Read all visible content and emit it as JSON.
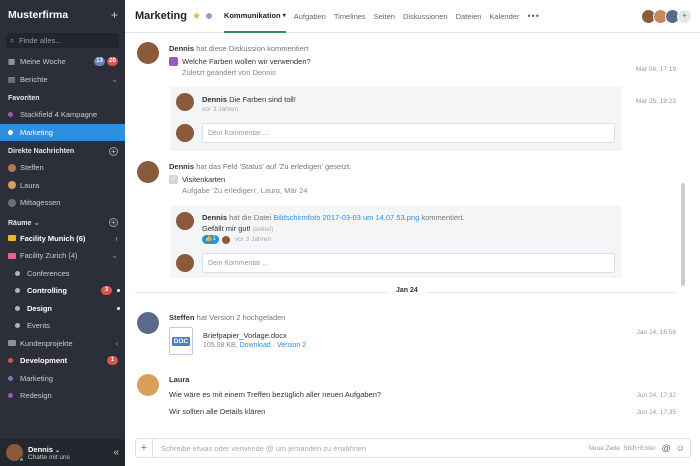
{
  "sidebar": {
    "workspace": "Musterfirma",
    "search_placeholder": "Finde alles...",
    "top_items": [
      {
        "label": "Meine Woche",
        "badge1": "13",
        "badge2": "20"
      },
      {
        "label": "Berichte"
      }
    ],
    "favorites_title": "Favoriten",
    "favorites": [
      {
        "label": "Stackfield 4 Kampagne",
        "color": "#9b59b6"
      },
      {
        "label": "Marketing",
        "color": "#ffffff"
      }
    ],
    "dm_title": "Direkte Nachrichten",
    "dms": [
      {
        "label": "Steffen"
      },
      {
        "label": "Laura"
      },
      {
        "label": "Mittagessen"
      }
    ],
    "rooms_title": "Räume",
    "rooms": [
      {
        "label": "Facility Munich (6)",
        "type": "folder",
        "color": "#f0b429"
      },
      {
        "label": "Facility Zurich (4)",
        "type": "folder",
        "color": "#e95f8e"
      },
      {
        "label": "Conferences",
        "type": "sub"
      },
      {
        "label": "Controlling",
        "type": "sub",
        "badge": "3"
      },
      {
        "label": "Design",
        "type": "sub"
      },
      {
        "label": "Events",
        "type": "sub"
      },
      {
        "label": "Kundenprojekte",
        "type": "folder",
        "color": "#8e8ea0"
      },
      {
        "label": "Development",
        "type": "item",
        "color": "#d9534f",
        "badge": "1"
      },
      {
        "label": "Marketing",
        "type": "item",
        "color": "#6a84b8"
      },
      {
        "label": "Redesign",
        "type": "item",
        "color": "#9b59b6"
      }
    ],
    "user_name": "Dennis",
    "user_status": "Chatte mit uns"
  },
  "header": {
    "title": "Marketing",
    "tabs": [
      "Kommunikation",
      "Aufgaben",
      "Timelines",
      "Seiten",
      "Diskussionen",
      "Dateien",
      "Kalender"
    ]
  },
  "feed": {
    "e1": {
      "name": "Dennis",
      "action": "hat diese Diskussion kommentiert",
      "topic": "Welche Farben wollen wir verwenden?",
      "changed": "Zuletzt geändert von Dennis",
      "date": "Mar 06, 17:19",
      "reply_name": "Dennis",
      "reply_text": "Die Farben sind toll!",
      "reply_age": "vor 3 Jahren",
      "reply_date": "Mar 25, 19:23",
      "comment_ph": "Dein Kommentar ..."
    },
    "e2": {
      "name": "Dennis",
      "action": "hat das Feld 'Status' auf 'Zu erledigen' gesetzt.",
      "task": "Visitenkarten",
      "task_sub": "Aufgabe 'Zu erledigen', Laura, Mär 24",
      "reply_name": "Dennis",
      "reply_pre": "hat die Datei",
      "reply_file": "Bildschirmfoto 2017-03-03 um 14.07.53.png",
      "reply_post": "kommentiert.",
      "reply_text": "Gefällt mir gut!",
      "edited": "(edited)",
      "likes": "1",
      "reply_age": "vor 3 Jahren",
      "comment_ph": "Dein Kommentar ..."
    },
    "divider": "Jan 24",
    "e3": {
      "name": "Steffen",
      "action": "hat Version 2 hochgeladen",
      "file": "Briefpapier_Vorlage.docx",
      "size": "105.08 KB,",
      "download": "Download",
      "version": "· Version 2",
      "date": "Jan 24, 16:58",
      "doc_label": "DOC"
    },
    "e4": {
      "name": "Laura",
      "msg1": "Wie wäre es mit einem Treffen bezüglich aller neuen Aufgaben?",
      "date1": "Jun 24, 17:32",
      "msg2": "Wir sollten alle Details klären",
      "date2": "Jun 24, 17:35"
    }
  },
  "composer": {
    "placeholder": "Schreibe etwas oder verwende @ um jemanden zu erwähnen",
    "hint": "Neue Zeile: Shift+Enter"
  },
  "colors": {
    "sidebar": "#2c2f3a",
    "accent": "#2d8fe0",
    "tab_underline": "#3a8c55"
  }
}
